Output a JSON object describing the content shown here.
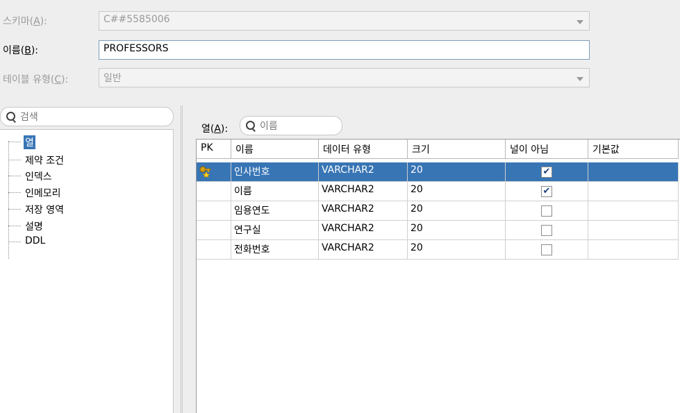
{
  "form": {
    "schema_label_pre": "스키마(",
    "schema_label_key": "A",
    "schema_label_post": "):",
    "schema_value": "C##5585006",
    "name_label_pre": "이름(",
    "name_label_key": "B",
    "name_label_post": "):",
    "name_value": "PROFESSORS",
    "type_label_pre": "테이블 유형(",
    "type_label_key": "C",
    "type_label_post": "):",
    "type_value": "일반"
  },
  "left_search": {
    "placeholder": "검색"
  },
  "tree": {
    "items": [
      "열",
      "제약 조건",
      "인덱스",
      "인메모리",
      "저장 영역",
      "설명",
      "DDL"
    ],
    "selected_index": 0
  },
  "columns_panel": {
    "label_pre": "열(",
    "label_key": "A",
    "label_post": "):",
    "search_placeholder": "이름",
    "headers": [
      "PK",
      "이름",
      "데이터 유형",
      "크기",
      "널이 아님",
      "기본값"
    ],
    "rows": [
      {
        "pk": true,
        "name": "인사번호",
        "type": "VARCHAR2",
        "size": "20",
        "not_null": true
      },
      {
        "pk": false,
        "name": "이름",
        "type": "VARCHAR2",
        "size": "20",
        "not_null": true
      },
      {
        "pk": false,
        "name": "임용연도",
        "type": "VARCHAR2",
        "size": "20",
        "not_null": false
      },
      {
        "pk": false,
        "name": "연구실",
        "type": "VARCHAR2",
        "size": "20",
        "not_null": false
      },
      {
        "pk": false,
        "name": "전화번호",
        "type": "VARCHAR2",
        "size": "20",
        "not_null": false
      }
    ],
    "selected_row": 0
  },
  "colors": {
    "selection": "#3875b5",
    "checkmark": "#1f3f7a",
    "key_gold": "#d4a017"
  },
  "icons": {
    "pk": "primary-key-icon",
    "check": "✔"
  }
}
